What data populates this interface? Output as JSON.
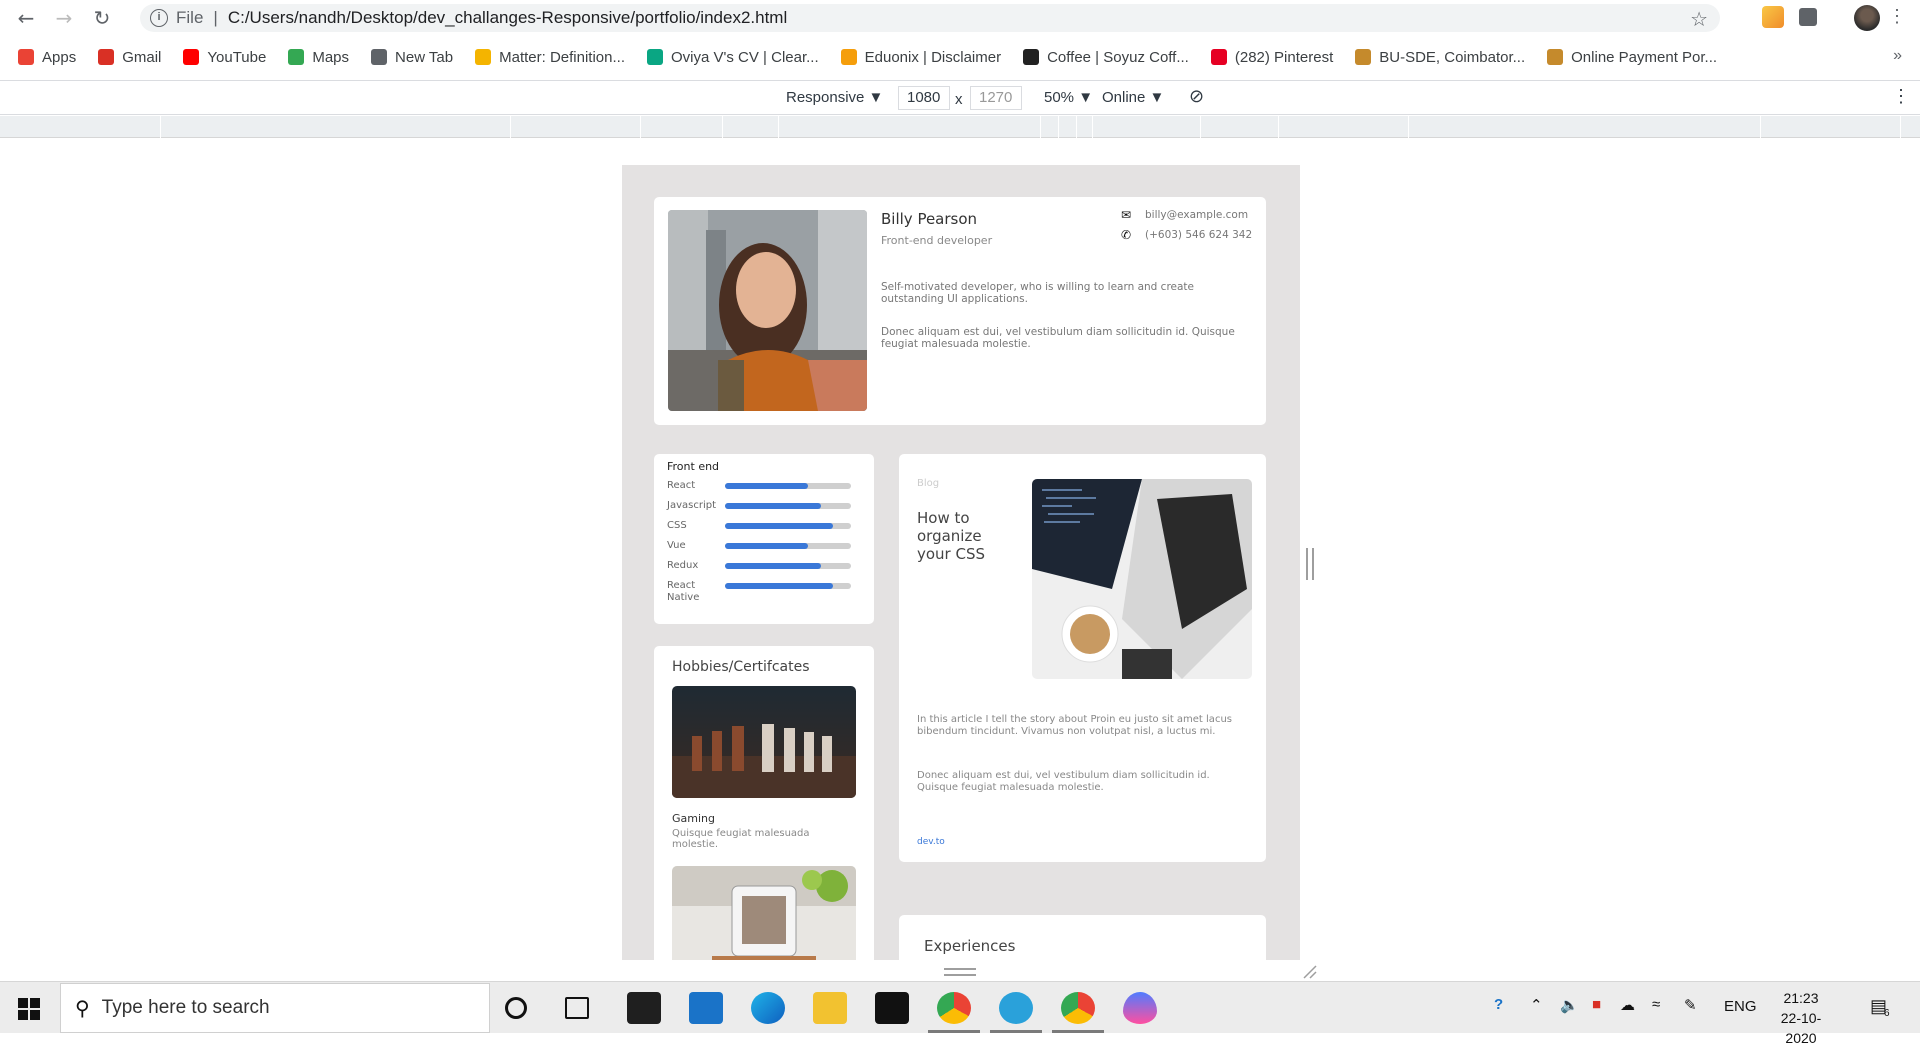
{
  "browser": {
    "url_protocol": "File",
    "url_path": "C:/Users/nandh/Desktop/dev_challanges-Responsive/portfolio/index2.html",
    "bookmarks": [
      {
        "label": "Apps",
        "color": "#ea4335"
      },
      {
        "label": "Gmail",
        "color": "#d93025"
      },
      {
        "label": "YouTube",
        "color": "#ff0000"
      },
      {
        "label": "Maps",
        "color": "#34a853"
      },
      {
        "label": "New Tab",
        "color": "#5f6368"
      },
      {
        "label": "Matter: Definition...",
        "color": "#f4b400"
      },
      {
        "label": "Oviya V's CV | Clear...",
        "color": "#0aa683"
      },
      {
        "label": "Eduonix | Disclaimer",
        "color": "#f59e0b"
      },
      {
        "label": "Coffee | Soyuz Coff...",
        "color": "#222222"
      },
      {
        "label": "(282) Pinterest",
        "color": "#e60023"
      },
      {
        "label": "BU-SDE, Coimbator...",
        "color": "#c58a2c"
      },
      {
        "label": "Online Payment Por...",
        "color": "#c58a2c"
      }
    ],
    "more": "»"
  },
  "devtools": {
    "device": "Responsive ▼",
    "width": "1080",
    "x": "x",
    "height": "1270",
    "zoom": "50% ▼",
    "throttle": "Online ▼"
  },
  "profile": {
    "name": "Billy Pearson",
    "role": "Front-end developer",
    "email": "billy@example.com",
    "phone": "(+603) 546 624 342",
    "bio1": "Self-motivated developer, who is willing to learn and create outstanding UI applications.",
    "bio2": "Donec aliquam est dui, vel vestibulum diam sollicitudin id. Quisque feugiat malesuada molestie."
  },
  "skills": {
    "title": "Front end",
    "items": [
      {
        "name": "React",
        "level": 0.66
      },
      {
        "name": "Javascript",
        "level": 0.76
      },
      {
        "name": "CSS",
        "level": 0.86
      },
      {
        "name": "Vue",
        "level": 0.66
      },
      {
        "name": "Redux",
        "level": 0.76
      },
      {
        "name": "React Native",
        "level": 0.86
      }
    ],
    "bar_color": "#3a78d8"
  },
  "hobbies": {
    "title": "Hobbies/Certifcates",
    "item_name": "Gaming",
    "item_desc": "Quisque feugiat malesuada molestie."
  },
  "blog": {
    "tag": "Blog",
    "title": "How to organize your CSS",
    "text1": "In this article I tell the story about Proin eu justo sit amet lacus bibendum tincidunt. Vivamus non volutpat nisl, a luctus mi.",
    "text2": "Donec aliquam est dui, vel vestibulum diam sollicitudin id. Quisque feugiat malesuada molestie.",
    "link": "dev.to"
  },
  "experiences": {
    "title": "Experiences"
  },
  "taskbar": {
    "search_placeholder": "Type here to search",
    "lang": "ENG",
    "time": "21:23",
    "date": "22-10-2020",
    "notif_count": "6"
  }
}
